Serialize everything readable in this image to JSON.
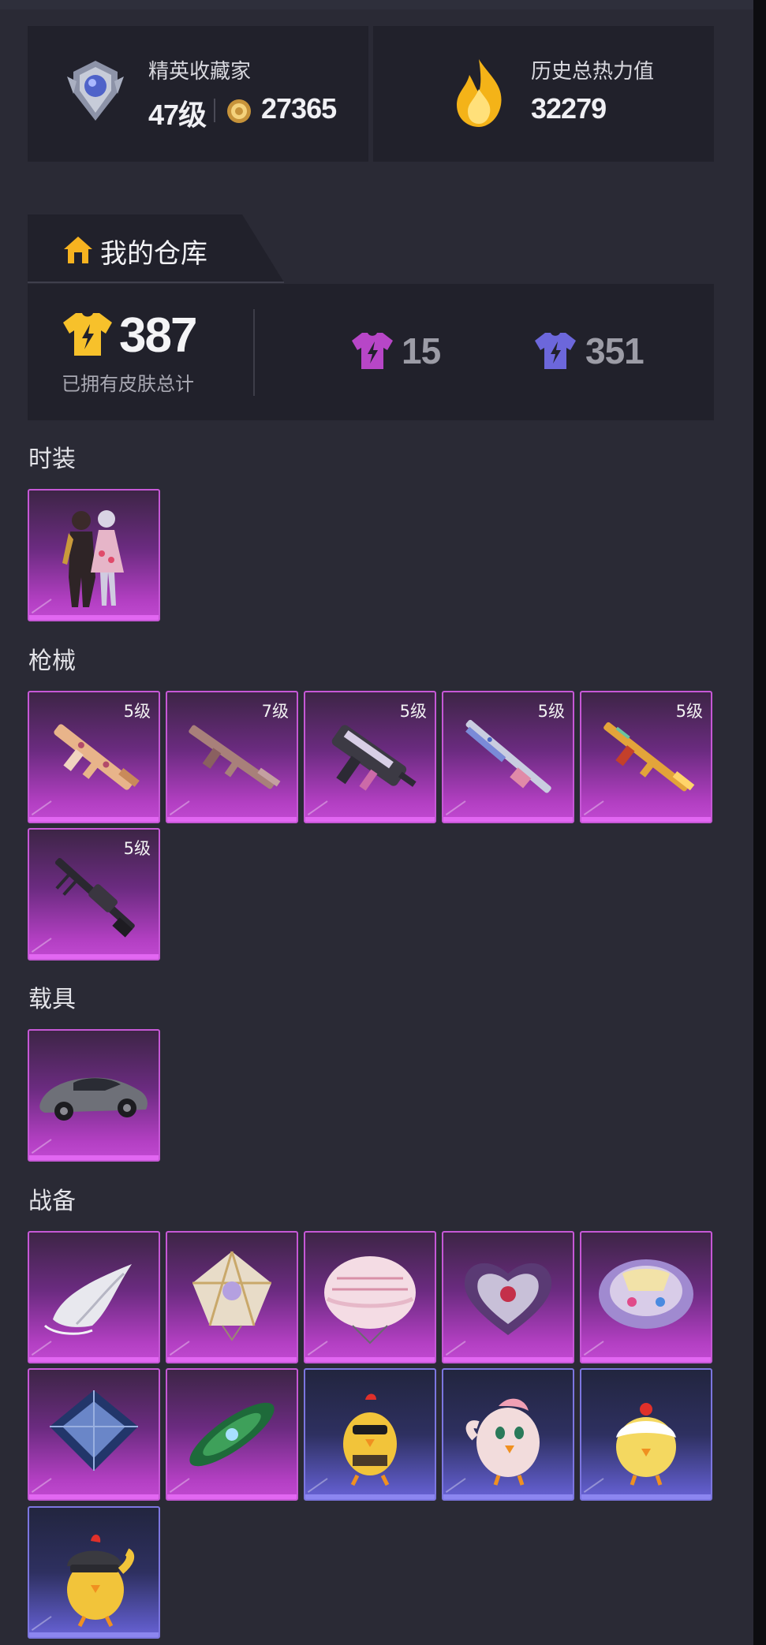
{
  "profile": {
    "title": "精英收藏家",
    "level": "47级",
    "points": "27365",
    "heat_label": "历史总热力值",
    "heat_value": "32279"
  },
  "warehouse": {
    "tab_label": "我的仓库",
    "total_value": "387",
    "total_label": "已拥有皮肤总计",
    "purple_count": "15",
    "blue_count": "351",
    "colors": {
      "gold": "#f7c12b",
      "purple": "#b746c7",
      "blue": "#6c67db"
    }
  },
  "sections": {
    "fashion": {
      "title": "时装",
      "items": [
        {
          "icon": "outfit-icon",
          "rarity": "purple",
          "level": ""
        }
      ]
    },
    "guns": {
      "title": "枪械",
      "items": [
        {
          "icon": "rifle-icon",
          "rarity": "purple",
          "level": "5级"
        },
        {
          "icon": "rifle-icon",
          "rarity": "purple",
          "level": "7级"
        },
        {
          "icon": "smg-icon",
          "rarity": "purple",
          "level": "5级"
        },
        {
          "icon": "shotgun-icon",
          "rarity": "purple",
          "level": "5级"
        },
        {
          "icon": "rifle-icon",
          "rarity": "purple",
          "level": "5级"
        },
        {
          "icon": "machine-gun-icon",
          "rarity": "purple",
          "level": "5级"
        }
      ]
    },
    "vehicles": {
      "title": "载具",
      "items": [
        {
          "icon": "car-icon",
          "rarity": "purple",
          "level": ""
        }
      ]
    },
    "gear": {
      "title": "战备",
      "items": [
        {
          "icon": "glider-icon",
          "rarity": "purple",
          "level": ""
        },
        {
          "icon": "parachute-icon",
          "rarity": "purple",
          "level": ""
        },
        {
          "icon": "parachute-icon",
          "rarity": "purple",
          "level": ""
        },
        {
          "icon": "heart-parachute-icon",
          "rarity": "purple",
          "level": ""
        },
        {
          "icon": "parachute-icon",
          "rarity": "purple",
          "level": ""
        },
        {
          "icon": "parachute-icon",
          "rarity": "purple",
          "level": ""
        },
        {
          "icon": "glider-icon",
          "rarity": "purple",
          "level": ""
        },
        {
          "icon": "chicken-icon",
          "rarity": "blue",
          "level": ""
        },
        {
          "icon": "chicken-icon",
          "rarity": "blue",
          "level": ""
        },
        {
          "icon": "chicken-icon",
          "rarity": "blue",
          "level": ""
        },
        {
          "icon": "chicken-icon",
          "rarity": "blue",
          "level": ""
        }
      ]
    }
  }
}
